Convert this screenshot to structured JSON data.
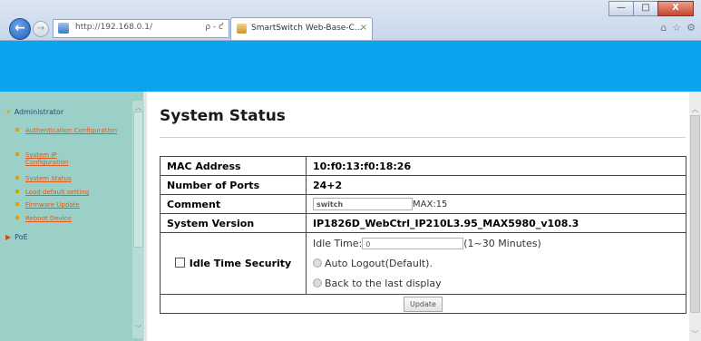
{
  "browser": {
    "url": "http://192.168.0.1/",
    "address_tools": "ρ - ƈ",
    "tab_title": "SmartSwitch Web-Base-C...",
    "tab_close": "×",
    "window_buttons": [
      "—",
      "□",
      "X"
    ],
    "chrome_icons": [
      "⌂",
      "☆",
      "⚙"
    ],
    "back_glyph": "←",
    "forward_glyph": "→"
  },
  "sidebar": {
    "administrator_label": "Administrator",
    "items": [
      {
        "label": "Authentication Configuration"
      },
      {
        "label": "System IP Configuration"
      },
      {
        "label": "System Status"
      },
      {
        "label": "Load default setting"
      },
      {
        "label": "Firmware Update"
      },
      {
        "label": "Reboot Device"
      }
    ],
    "poe_label": "PoE"
  },
  "main": {
    "title": "System Status",
    "rows": {
      "mac_label": "MAC Address",
      "mac_value": "10:f0:13:f0:18:26",
      "ports_label": "Number of Ports",
      "ports_value": "24+2",
      "comment_label": "Comment",
      "comment_value": "switch",
      "comment_max": "MAX:15",
      "version_label": "System Version",
      "version_value": "IP1826D_WebCtrl_IP210L3.95_MAX5980_v108.3",
      "idle_label": "Idle Time Security",
      "idle_time_label": "Idle Time:",
      "idle_time_value": "0",
      "idle_time_range": "(1~30 Minutes)",
      "auto_logout_label": "Auto Logout(Default).",
      "back_last_label": "Back to the last display"
    },
    "update_label": "Update"
  },
  "colors": {
    "banner": "#0aa4ef",
    "sidebar_bg": "#9ad0c7",
    "sidebar_link": "#e05a1c"
  }
}
